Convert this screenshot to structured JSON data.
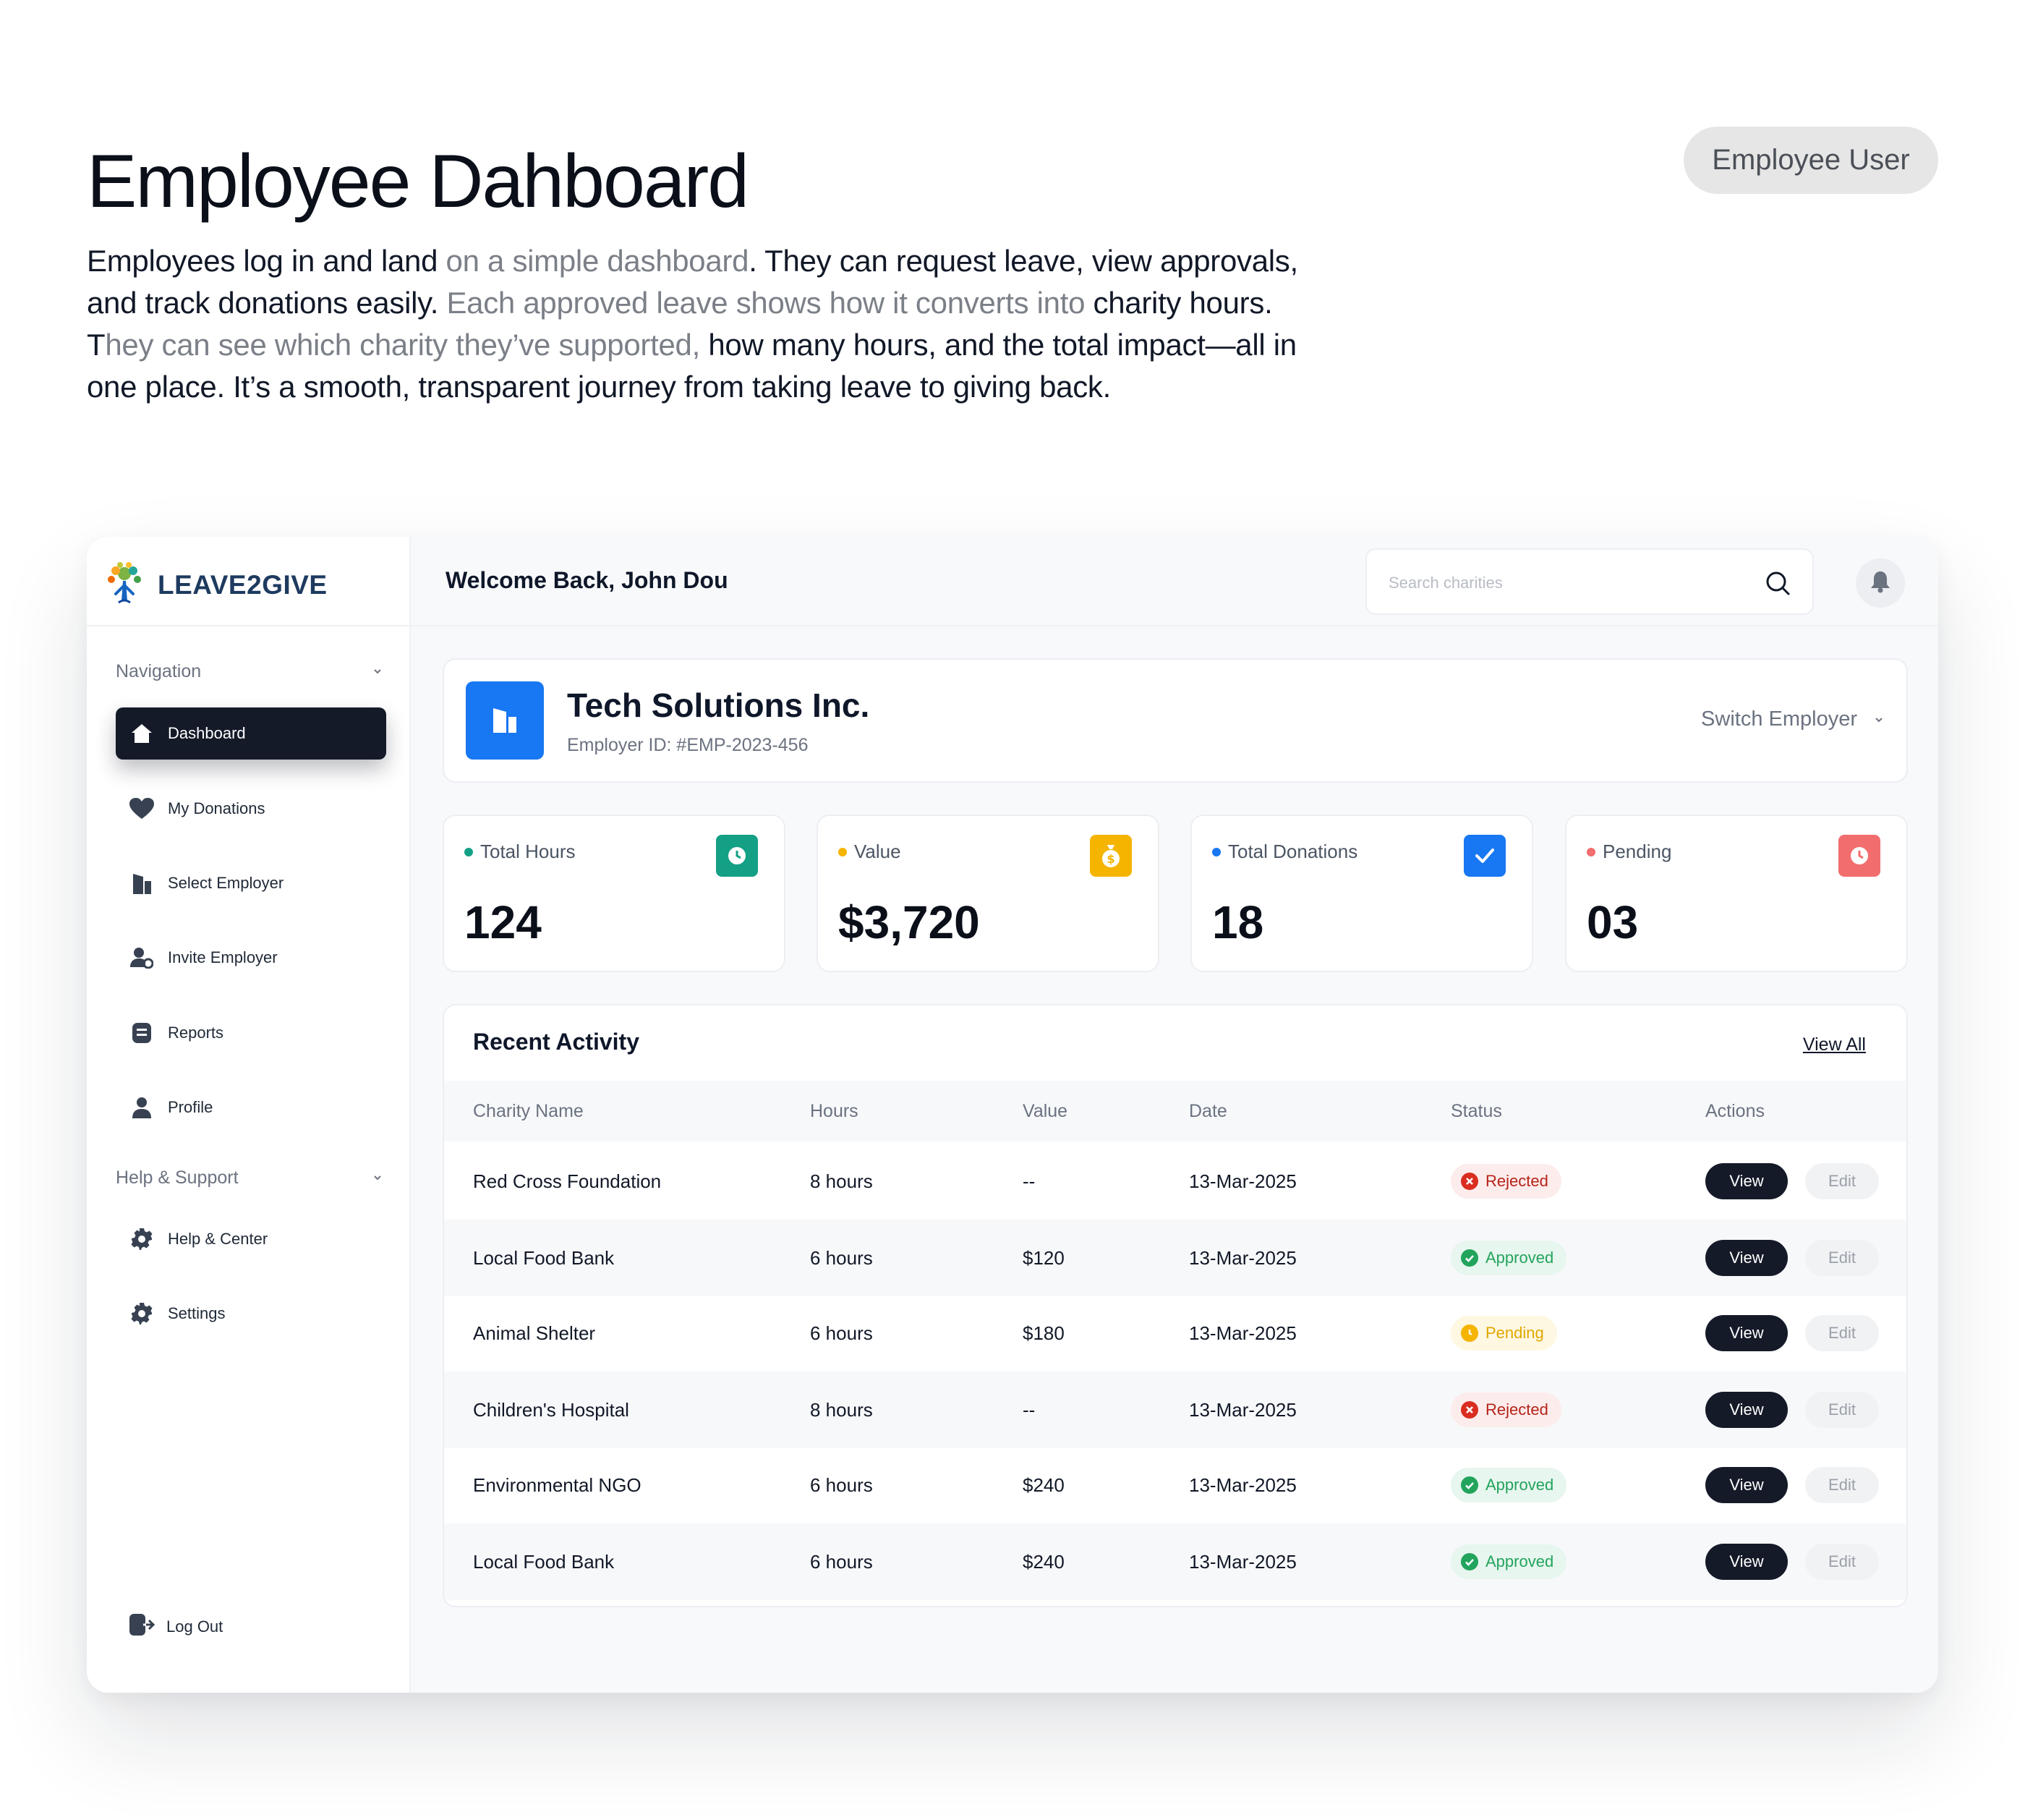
{
  "hero": {
    "title": "Employee Dahboard",
    "role": "Employee User",
    "desc": {
      "p1": "Employees log in and land ",
      "m1": "on a simple dashboard",
      "p2": ". They can request leave, view approvals, and track donations easily. ",
      "m2": "Each approved leave shows how it converts into ",
      "p3": "charity hours. T",
      "m3": "hey can see which charity they’ve supported, ",
      "p4": "how many hours, and the total impact—all in one place. It’s a smooth, transparent journey from taking leave to giving back."
    }
  },
  "app": {
    "brand": "LEAVE2GIVE",
    "welcome": "Welcome Back, John Dou",
    "search": {
      "placeholder": "Search charities",
      "value": ""
    }
  },
  "sidebar": {
    "nav_title": "Navigation",
    "items": [
      {
        "label": "Dashboard",
        "icon": "home-icon",
        "active": true
      },
      {
        "label": "My Donations",
        "icon": "heart-icon"
      },
      {
        "label": "Select Employer",
        "icon": "building-icon"
      },
      {
        "label": "Invite Employer",
        "icon": "user-plus-icon"
      },
      {
        "label": "Reports",
        "icon": "document-icon"
      },
      {
        "label": "Profile",
        "icon": "user-icon"
      }
    ],
    "help_title": "Help & Support",
    "help_items": [
      {
        "label": "Help & Center",
        "icon": "gear-icon"
      },
      {
        "label": "Settings",
        "icon": "gear-icon"
      }
    ],
    "logout": "Log Out"
  },
  "employer": {
    "name": "Tech Solutions Inc.",
    "id": "Employer ID: #EMP-2023-456",
    "switch": "Switch Employer"
  },
  "stats": [
    {
      "label": "Total Hours",
      "value": "124",
      "color": "#14a085",
      "icon": "clock-icon"
    },
    {
      "label": "Value",
      "value": "$3,720",
      "color": "#f5b400",
      "icon": "money-bag-icon"
    },
    {
      "label": "Total Donations",
      "value": "18",
      "color": "#1877f2",
      "icon": "check-icon"
    },
    {
      "label": "Pending",
      "value": "03",
      "color": "#f26d6d",
      "icon": "clock-icon"
    }
  ],
  "activity": {
    "title": "Recent Activity",
    "view_all": "View All",
    "columns": [
      "Charity Name",
      "Hours",
      "Value",
      "Date",
      "Status",
      "Actions"
    ],
    "view_label": "View",
    "edit_label": "Edit",
    "rows": [
      {
        "charity": "Red Cross Foundation",
        "hours": "8 hours",
        "value": "--",
        "date": "13-Mar-2025",
        "status": "Rejected"
      },
      {
        "charity": "Local Food Bank",
        "hours": "6 hours",
        "value": "$120",
        "date": "13-Mar-2025",
        "status": "Approved"
      },
      {
        "charity": "Animal Shelter",
        "hours": "6 hours",
        "value": "$180",
        "date": "13-Mar-2025",
        "status": "Pending"
      },
      {
        "charity": "Children's Hospital",
        "hours": "8 hours",
        "value": "--",
        "date": "13-Mar-2025",
        "status": "Rejected"
      },
      {
        "charity": "Environmental NGO",
        "hours": "6 hours",
        "value": "$240",
        "date": "13-Mar-2025",
        "status": "Approved"
      },
      {
        "charity": "Local Food Bank",
        "hours": "6 hours",
        "value": "$240",
        "date": "13-Mar-2025",
        "status": "Approved"
      }
    ]
  }
}
